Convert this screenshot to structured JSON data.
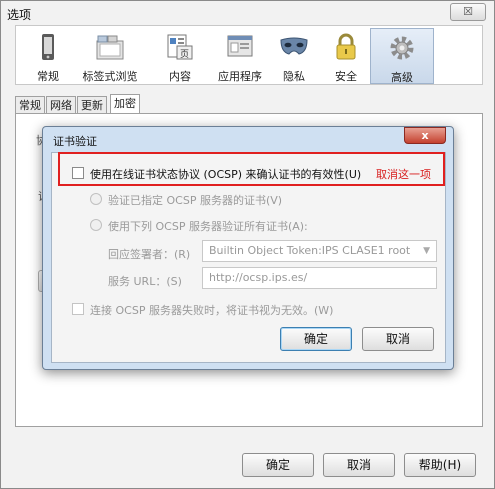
{
  "window": {
    "title": "选项",
    "close_label": "☒"
  },
  "toolbar": {
    "items": [
      {
        "label": "常规",
        "icon": "phone-icon"
      },
      {
        "label": "标签式浏览",
        "icon": "tabs-icon"
      },
      {
        "label": "内容",
        "icon": "content-icon"
      },
      {
        "label": "应用程序",
        "icon": "applications-icon"
      },
      {
        "label": "隐私",
        "icon": "mask-icon"
      },
      {
        "label": "安全",
        "icon": "lock-icon"
      },
      {
        "label": "高级",
        "icon": "gear-icon"
      }
    ],
    "active_index": 6
  },
  "subtabs": [
    "常规",
    "网络",
    "更新",
    "加密"
  ],
  "subtab_active_index": 3,
  "background_fragments": [
    "协",
    "证"
  ],
  "footer": {
    "ok": "确定",
    "cancel": "取消",
    "help": "帮助(H)"
  },
  "dialog": {
    "title": "证书验证",
    "close_label": "x",
    "ocsp_checkbox": "使用在线证书状态协议 (OCSP) 来确认证书的有效性(U)",
    "radio_specified": "验证已指定 OCSP 服务器的证书(V)",
    "radio_all": "使用下列 OCSP 服务器验证所有证书(A):",
    "responder_label": "回应签署者：(R)",
    "responder_value": "Builtin Object Token:IPS CLASE1 root",
    "url_label": "服务 URL：(S)",
    "url_value": "http://ocsp.ips.es/",
    "fail_checkbox": "连接 OCSP 服务器失败时，将证书视为无效。(W)",
    "ok": "确定",
    "cancel": "取消"
  },
  "annotation": {
    "text": "取消这一项",
    "color": "#d81e1e"
  },
  "colors": {
    "dialog_frame": "#cfe0f2",
    "highlight": "#e02020",
    "close_button": "#c4412f"
  }
}
